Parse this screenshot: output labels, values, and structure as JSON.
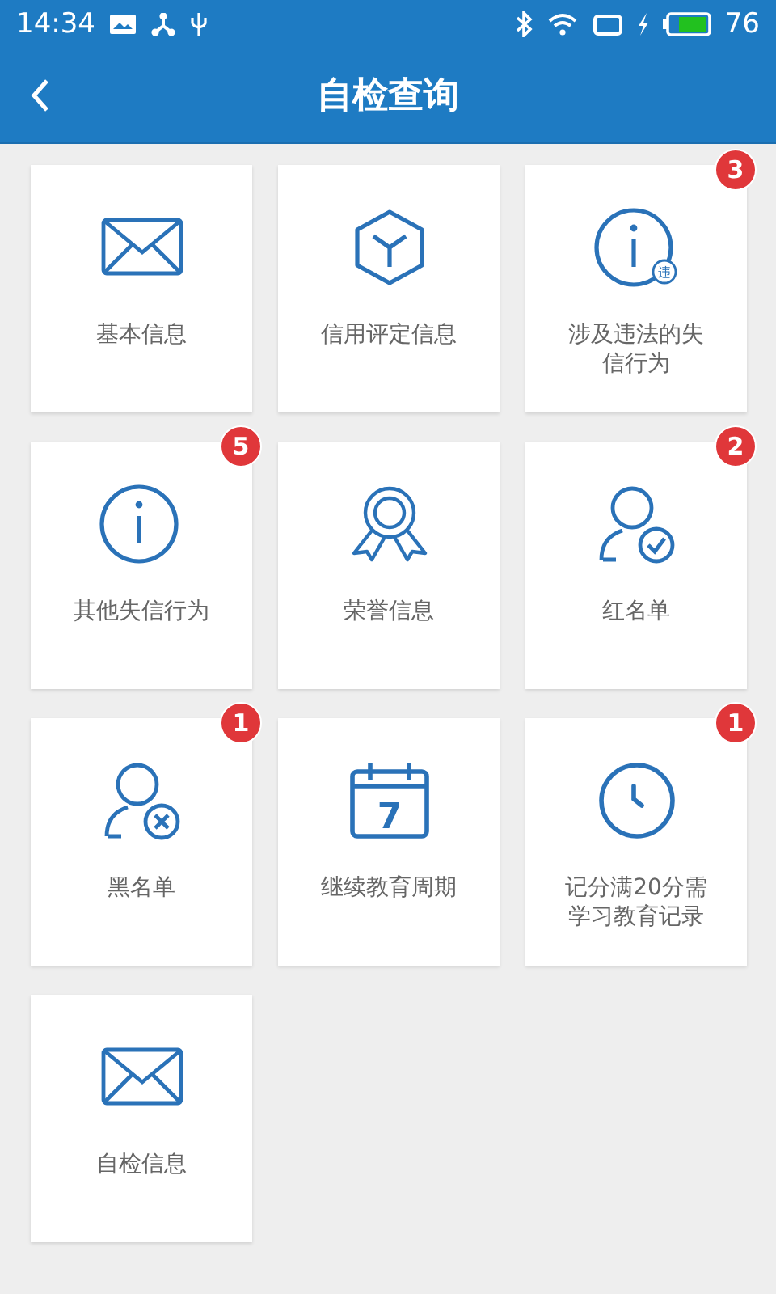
{
  "status_bar": {
    "time": "14:34",
    "battery_text": "76"
  },
  "header": {
    "title": "自检查询"
  },
  "items": [
    {
      "kind": "envelope",
      "label": "基本信息"
    },
    {
      "kind": "cube",
      "label": "信用评定信息"
    },
    {
      "kind": "info-mark",
      "label": "涉及违法的失信行为",
      "badge": "3",
      "icon_text": "违"
    },
    {
      "kind": "info",
      "label": "其他失信行为",
      "badge": "5"
    },
    {
      "kind": "ribbon",
      "label": "荣誉信息"
    },
    {
      "kind": "user-check",
      "label": "红名单",
      "badge": "2"
    },
    {
      "kind": "user-cross",
      "label": "黑名单",
      "badge": "1"
    },
    {
      "kind": "calendar",
      "label": "继续教育周期",
      "icon_text": "7"
    },
    {
      "kind": "clock",
      "label": "记分满20分需学习教育记录",
      "badge": "1"
    },
    {
      "kind": "envelope",
      "label": "自检信息"
    }
  ]
}
